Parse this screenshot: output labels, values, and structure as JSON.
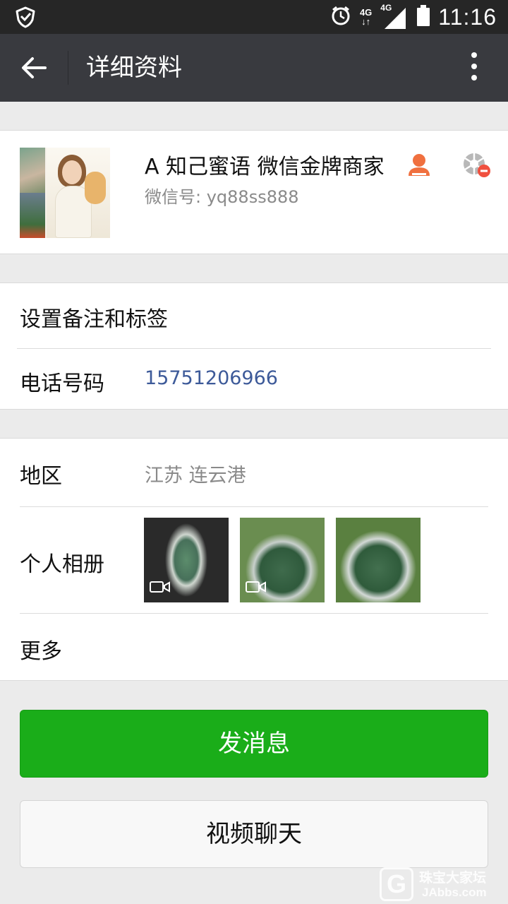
{
  "status_bar": {
    "network_up": "4G",
    "network_down": "4G",
    "time": "11:16"
  },
  "app_bar": {
    "title": "详细资料"
  },
  "profile": {
    "name": "A 知己蜜语 微信金牌商家",
    "wechat_id": "微信号: yq88ss888"
  },
  "rows": {
    "remark": {
      "label": "设置备注和标签"
    },
    "phone": {
      "label": "电话号码",
      "value": "15751206966"
    },
    "region": {
      "label": "地区",
      "value": "江苏  连云港"
    },
    "album": {
      "label": "个人相册"
    },
    "more": {
      "label": "更多"
    }
  },
  "buttons": {
    "send_message": "发消息",
    "video_call": "视频聊天"
  },
  "watermark": {
    "glyph": "G",
    "line1": "珠宝大家坛",
    "line2": "JAbbs.com"
  },
  "colors": {
    "app_bar": "#393a3f",
    "status_bar": "#262626",
    "primary_green": "#1aad19",
    "link_blue": "#3d5a99",
    "accent_orange": "#f0703f"
  },
  "icons": {
    "status_left": "shield-check-icon",
    "alarm": "alarm-clock-icon",
    "signal": "signal-bars-icon",
    "battery": "battery-icon",
    "back": "arrow-left-icon",
    "overflow": "more-vertical-icon",
    "contact_badge": "person-icon",
    "moments_blocked": "shutter-blocked-icon",
    "video_badge": "video-camera-icon"
  }
}
